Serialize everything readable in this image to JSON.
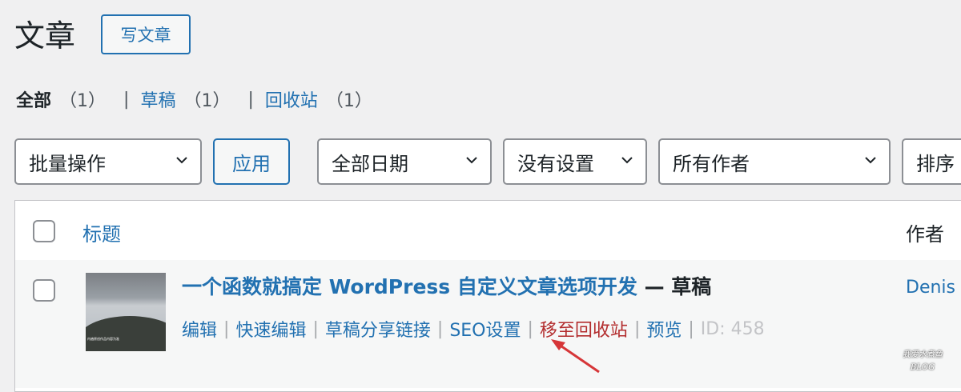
{
  "header": {
    "title": "文章",
    "add_new": "写文章"
  },
  "views": [
    {
      "label": "全部",
      "count": "（1）",
      "current": true
    },
    {
      "label": "草稿",
      "count": "（1）"
    },
    {
      "label": "回收站",
      "count": "（1）"
    }
  ],
  "view_separator": "|",
  "filters": {
    "bulk_action": "批量操作",
    "apply": "应用",
    "date": "全部日期",
    "seo": "没有设置",
    "author": "所有作者",
    "sort": "排序"
  },
  "table": {
    "columns": {
      "title": "标题",
      "author": "作者"
    },
    "rows": [
      {
        "title": "一个函数就搞定 WordPress 自定义文章选项开发",
        "state": " — 草稿",
        "thumbnail_caption": "内遍原创作品内容为准",
        "author": "Denis",
        "actions": {
          "edit": "编辑",
          "quick_edit": "快速编辑",
          "draft_share": "草稿分享链接",
          "seo": "SEO设置",
          "trash": "移至回收站",
          "preview": "预览",
          "id": "ID: 458"
        }
      }
    ]
  },
  "watermark": {
    "line1": "我爱水煮鱼",
    "line2": "BLOG"
  },
  "colors": {
    "link": "#2271b1",
    "trash": "#b32d2e",
    "annotation_arrow": "#d63638"
  }
}
